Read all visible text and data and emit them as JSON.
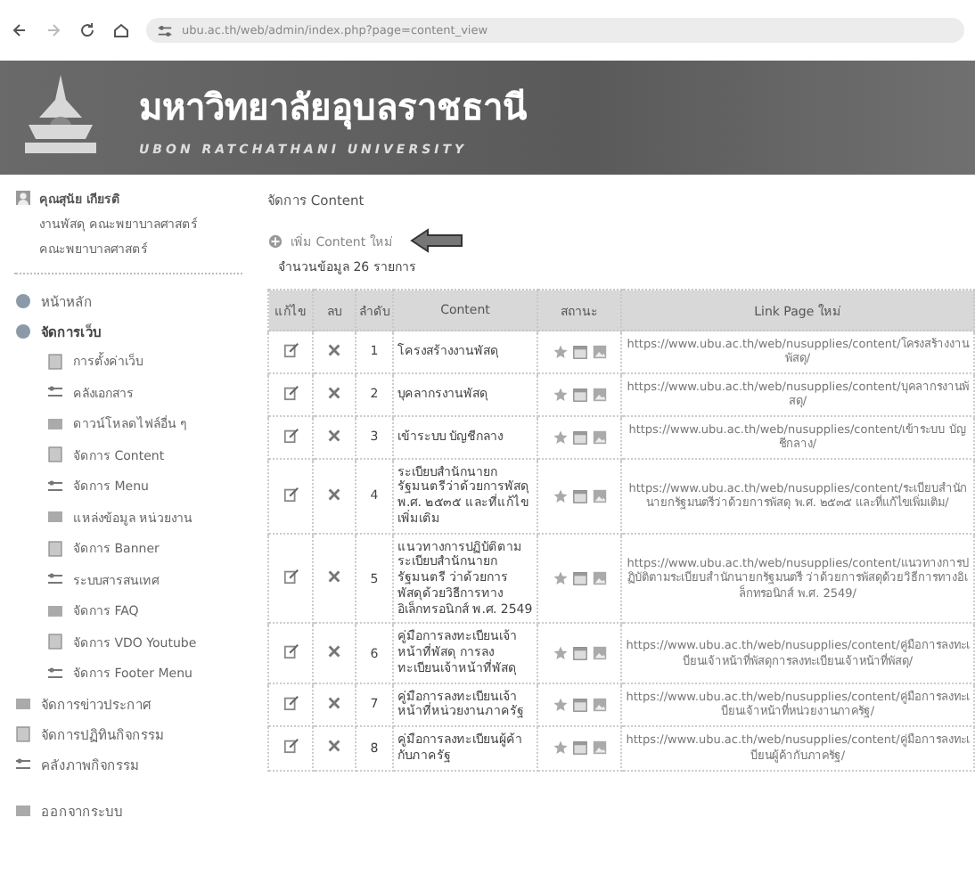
{
  "browser": {
    "url": "ubu.ac.th/web/admin/index.php?page=content_view"
  },
  "header": {
    "title": "มหาวิทยาลัยอุบลราชธานี",
    "subtitle": "UBON RATCHATHANI UNIVERSITY"
  },
  "sidebar": {
    "user": {
      "name": "คุณสุนัย เกียรติ",
      "unit": [
        "งานพัสดุ คณะพยาบาลศาสตร์",
        "คณะพยาบาลศาสตร์"
      ]
    },
    "items": [
      {
        "label": "หน้าหลัก",
        "expanded": false
      },
      {
        "label": "จัดการเว็บ",
        "expanded": true,
        "children": [
          {
            "label": "การตั้งค่าเว็บ"
          },
          {
            "label": "คลังเอกสาร"
          },
          {
            "label": "ดาวน์โหลดไฟล์อื่น ๆ"
          },
          {
            "label": "จัดการ Content"
          },
          {
            "label": "จัดการ Menu"
          },
          {
            "label": "แหล่งข้อมูล หน่วยงาน"
          },
          {
            "label": "จัดการ Banner"
          },
          {
            "label": "ระบบสารสนเทศ"
          },
          {
            "label": "จัดการ FAQ"
          },
          {
            "label": "จัดการ VDO Youtube"
          },
          {
            "label": "จัดการ Footer Menu"
          }
        ]
      },
      {
        "label": "จัดการข่าวประกาศ",
        "expanded": false
      },
      {
        "label": "จัดการปฏิทินกิจกรรม",
        "expanded": false
      },
      {
        "label": "คลังภาพกิจกรรม",
        "expanded": false
      },
      {
        "label": "ออกจากระบบ",
        "expanded": false
      }
    ]
  },
  "main": {
    "title": "จัดการ Content",
    "add_link": "เพิ่ม Content ใหม่",
    "count": "จำนวนข้อมูล 26 รายการ",
    "table": {
      "columns": [
        "แก้ไข",
        "ลบ",
        "ลำดับ",
        "Content",
        "สถานะ",
        "Link Page ใหม่"
      ],
      "rows": [
        {
          "order": "1",
          "content": "โครงสร้างงานพัสดุ",
          "link": "https://www.ubu.ac.th/web/nusupplies/content/โครงสร้างงานพัสดุ/"
        },
        {
          "order": "2",
          "content": "บุคลากรงานพัสดุ",
          "link": "https://www.ubu.ac.th/web/nusupplies/content/บุคลากรงานพัสดุ/"
        },
        {
          "order": "3",
          "content": "เข้าระบบ บัญชีกลาง",
          "link": "https://www.ubu.ac.th/web/nusupplies/content/เข้าระบบ บัญชีกลาง/"
        },
        {
          "order": "4",
          "content": "ระเบียบสำนักนายกรัฐมนตรีว่าด้วยการพัสดุ พ.ศ. ๒๕๓๕ และที่แก้ไขเพิ่มเติม",
          "link": "https://www.ubu.ac.th/web/nusupplies/content/ระเบียบสำนักนายกรัฐมนตรีว่าด้วยการพัสดุ พ.ศ. ๒๕๓๕ และที่แก้ไขเพิ่มเติม/"
        },
        {
          "order": "5",
          "content": "แนวทางการปฏิบัติตามระเบียบสำนักนายกรัฐมนตรี ว่าด้วยการพัสดุด้วยวิธีการทางอิเล็กทรอนิกส์ พ.ศ. 2549",
          "link": "https://www.ubu.ac.th/web/nusupplies/content/แนวทางการปฏิบัติตามระเบียบสำนักนายกรัฐมนตรี ว่าด้วยการพัสดุด้วยวิธีการทางอิเล็กทรอนิกส์ พ.ศ. 2549/"
        },
        {
          "order": "6",
          "content": "คู่มือการลงทะเบียนเจ้าหน้าที่พัสดุ การลงทะเบียนเจ้าหน้าที่พัสดุ",
          "link": "https://www.ubu.ac.th/web/nusupplies/content/คู่มือการลงทะเบียนเจ้าหน้าที่พัสดุการลงทะเบียนเจ้าหน้าที่พัสดุ/"
        },
        {
          "order": "7",
          "content": "คู่มือการลงทะเบียนเจ้าหน้าที่หน่วยงานภาครัฐ",
          "link": "https://www.ubu.ac.th/web/nusupplies/content/คู่มือการลงทะเบียนเจ้าหน้าที่หน่วยงานภาครัฐ/"
        },
        {
          "order": "8",
          "content": "คู่มือการลงทะเบียนผู้ค้ากับภาครัฐ",
          "link": "https://www.ubu.ac.th/web/nusupplies/content/คู่มือการลงทะเบียนผู้ค้ากับภาครัฐ/"
        }
      ]
    }
  }
}
